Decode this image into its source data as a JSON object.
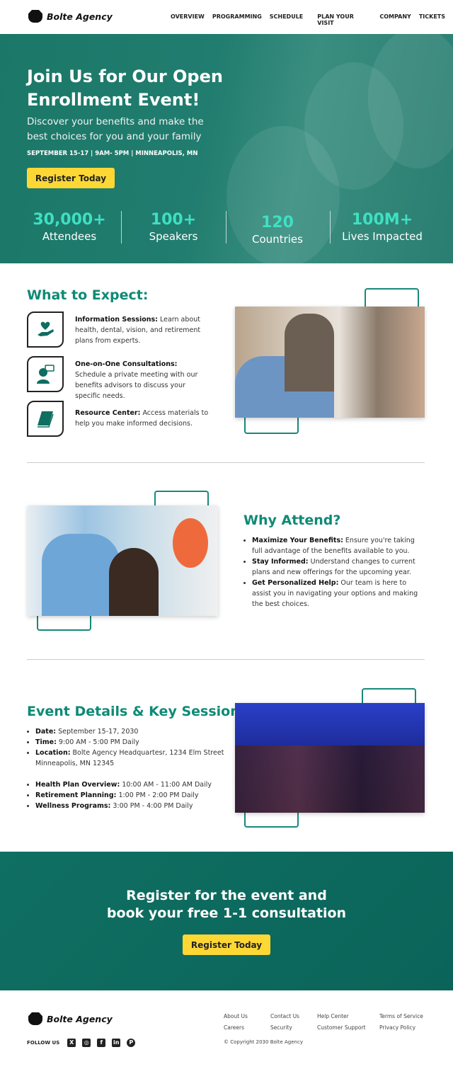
{
  "brand": {
    "name": "Bolte Agency"
  },
  "nav": {
    "items": [
      "OVERVIEW",
      "PROGRAMMING",
      "SCHEDULE",
      "PLAN YOUR VISIT",
      "COMPANY",
      "TICKETS"
    ]
  },
  "hero": {
    "title": "Join Us for Our Open Enrollment Event!",
    "subtitle": "Discover your benefits and make the best choices for you and your family",
    "meta": "SEPTEMBER 15-17 | 9AM- 5PM | MINNEAPOLIS, MN",
    "cta": "Register Today",
    "stats": [
      {
        "value": "30,000+",
        "label": "Attendees"
      },
      {
        "value": "100+",
        "label": "Speakers"
      },
      {
        "value": "120",
        "label": "Countries"
      },
      {
        "value": "100M+",
        "label": "Lives Impacted"
      }
    ]
  },
  "expect": {
    "title": "What to Expect:",
    "items": [
      {
        "icon": "heart-hand-icon",
        "title": "Information Sessions:",
        "text": " Learn about health, dental, vision, and retirement plans from experts."
      },
      {
        "icon": "consultation-icon",
        "title": "One-on-One Consultations:",
        "text": " Schedule a private meeting with our benefits advisors to discuss your specific needs."
      },
      {
        "icon": "book-icon",
        "title": "Resource Center:",
        "text": " Access materials to help you make informed decisions."
      }
    ]
  },
  "why": {
    "title": "Why Attend?",
    "items": [
      {
        "title": "Maximize Your Benefits:",
        "text": " Ensure you're taking full advantage of the benefits available to you."
      },
      {
        "title": "Stay Informed:",
        "text": " Understand changes to current plans and new offerings for the upcoming year."
      },
      {
        "title": "Get Personalized Help:",
        "text": " Our team is here to assist you in navigating your options and making the best choices."
      }
    ]
  },
  "details": {
    "title": "Event Details & Key Sessions",
    "items": [
      {
        "title": "Date:",
        "text": " September 15-17, 2030"
      },
      {
        "title": "Time:",
        "text": " 9:00 AM - 5:00 PM Daily"
      },
      {
        "title": "Location:",
        "text": " Bolte Agency Headquartesr, 1234 Elm Street Minneapolis, MN 12345"
      }
    ],
    "sessions": [
      {
        "title": "Health Plan Overview:",
        "text": " 10:00 AM - 11:00 AM Daily"
      },
      {
        "title": "Retirement Planning:",
        "text": " 1:00 PM - 2:00 PM Daily"
      },
      {
        "title": "Wellness Programs:",
        "text": " 3:00 PM - 4:00 PM Daily"
      }
    ]
  },
  "cta": {
    "line1": "Register for the event and",
    "line2": "book your free 1-1 consultation",
    "button": "Register Today"
  },
  "footer": {
    "follow": "FOLLOW US",
    "social": [
      "x-icon",
      "instagram-icon",
      "facebook-icon",
      "linkedin-icon",
      "pinterest-icon"
    ],
    "links": [
      [
        "About Us",
        "Careers"
      ],
      [
        "Contact Us",
        "Security"
      ],
      [
        "Help Center",
        "Customer Support"
      ],
      [
        "Terms of Service",
        "Privacy Policy"
      ]
    ],
    "copyright": "© Copyright 2030 Bolte Agency"
  },
  "colors": {
    "teal": "#0e8a75",
    "hero": "#1f7a6c",
    "accent": "#3ee0c2",
    "yellow": "#fdd835"
  }
}
